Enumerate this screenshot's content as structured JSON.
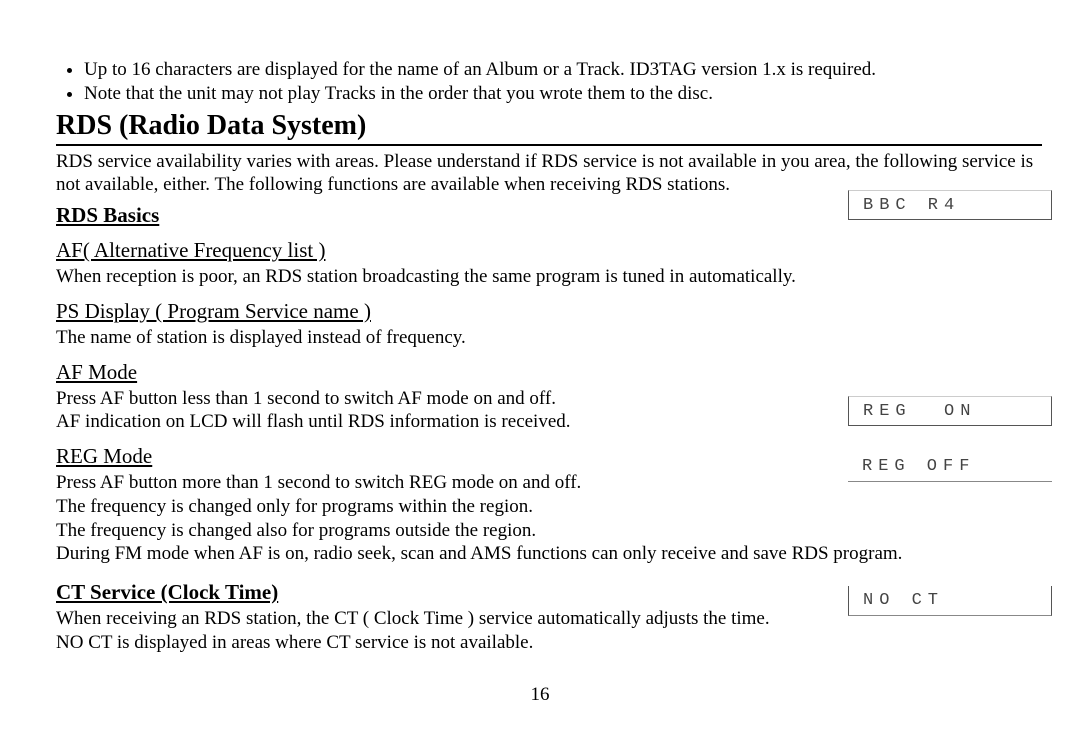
{
  "bullets": [
    "Up to 16 characters are displayed for the name of an Album or a Track. ID3TAG version 1.x is required.",
    "Note that the unit may not play Tracks in the order that you wrote them to the disc."
  ],
  "section_title": "RDS (Radio Data System)",
  "intro": "RDS service availability varies with areas. Please understand if RDS service is not available in you area, the following service is not available, either. The following functions are available when receiving RDS stations.",
  "rds_basics_label": "RDS Basics",
  "af_title": "AF( Alternative Frequency list )",
  "af_body": "When reception is poor, an RDS station broadcasting the same program is tuned in automatically.",
  "ps_title": "PS Display ( Program Service name )",
  "ps_body": "The name of station is displayed instead of frequency.",
  "afmode_title": "AF Mode",
  "afmode_body1": "Press AF button less than 1 second to switch AF mode on and off.",
  "afmode_body2": "AF indication on LCD will flash until RDS information is received.",
  "regmode_title": "REG Mode",
  "regmode_body1": "Press AF button more than 1 second to switch REG mode on and off.",
  "regmode_body2": "The frequency is changed only for programs within the region.",
  "regmode_body3": "The frequency is changed also for programs outside the region.",
  "regmode_body4": "During FM mode when AF is on, radio seek, scan and AMS functions can only receive and save RDS program.",
  "ct_title": "CT Service (Clock Time)",
  "ct_body1": "When receiving an RDS station, the CT ( Clock Time ) service automatically adjusts the time.",
  "ct_body2": "NO CT is displayed in areas where CT service is not available.",
  "page_number": "16",
  "lcd": {
    "bbc": "BBC R4",
    "reg_on": "REG  ON",
    "reg_off": "REG OFF",
    "no_ct": "NO CT"
  }
}
